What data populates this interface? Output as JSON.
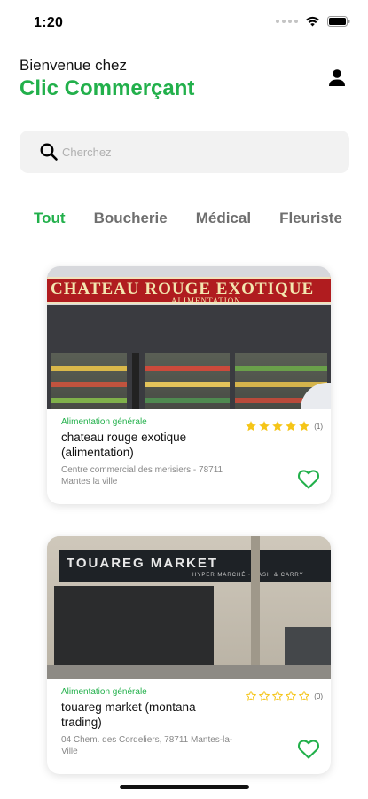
{
  "status_bar": {
    "time": "1:20"
  },
  "header": {
    "welcome": "Bienvenue chez",
    "brand": "Clic Commerçant",
    "profile_icon": "person-icon"
  },
  "search": {
    "placeholder": "Cherchez",
    "value": ""
  },
  "tabs": [
    {
      "label": "Tout",
      "active": true
    },
    {
      "label": "Boucherie",
      "active": false
    },
    {
      "label": "Médical",
      "active": false
    },
    {
      "label": "Fleuriste",
      "active": false
    }
  ],
  "shops": [
    {
      "category": "Alimentation générale",
      "name": "chateau rouge exotique (alimentation)",
      "address": "Centre commercial des merisiers - 78711 Mantes la ville",
      "rating_stars": 5,
      "rating_count": "(1)",
      "image_sign": "CHATEAU ROUGE EXOTIQUE",
      "image_sign_sub": "ALIMENTATION",
      "favorite": false
    },
    {
      "category": "Alimentation générale",
      "name": "touareg market (montana trading)",
      "address": "04 Chem. des Cordeliers, 78711 Mantes-la-Ville",
      "rating_stars": 0,
      "rating_count": "(0)",
      "image_sign": "TOUAREG MARKET",
      "image_sign_sub": "HYPER MARCHÉ · CASH & CARRY",
      "favorite": false
    }
  ],
  "colors": {
    "accent": "#22b04b",
    "star": "#f5c518",
    "search_bg": "#f2f2f2"
  }
}
